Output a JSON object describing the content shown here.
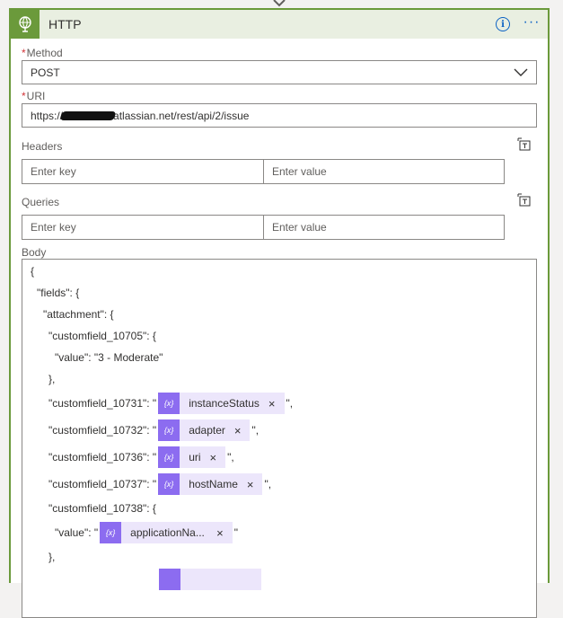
{
  "header": {
    "title": "HTTP",
    "info_glyph": "i",
    "more_glyph": "···",
    "accent": "#6b9a3b"
  },
  "method": {
    "label": "Method",
    "required_mark": "*",
    "value": "POST"
  },
  "uri": {
    "label": "URI",
    "required_mark": "*",
    "value_prefix": "https://",
    "value_suffix": "atlassian.net/rest/api/2/issue"
  },
  "headers": {
    "label": "Headers",
    "key_placeholder": "Enter key",
    "value_placeholder": "Enter value"
  },
  "queries": {
    "label": "Queries",
    "key_placeholder": "Enter key",
    "value_placeholder": "Enter value"
  },
  "body": {
    "label": "Body",
    "lines": {
      "l1": "{",
      "l2": "\"fields\": {",
      "l3": "\"attachment\": {",
      "l4": "\"customfield_10705\": {",
      "l5": "\"value\": \"3 - Moderate\"",
      "l6": "},",
      "l7_pre": "\"customfield_10731\": \"",
      "l7_post": "\",",
      "l8_pre": "\"customfield_10732\": \"",
      "l8_post": "\",",
      "l9_pre": "\"customfield_10736\": \"",
      "l9_post": "\",",
      "l10_pre": "\"customfield_10737\": \"",
      "l10_post": "\",",
      "l11": "\"customfield_10738\": {",
      "l12_pre": "\"value\": \"",
      "l12_post": "\"",
      "l13": "},"
    },
    "tokens": {
      "t1": "instanceStatus",
      "t2": "adapter",
      "t3": "uri",
      "t4": "hostName",
      "t5": "applicationNa..."
    },
    "token_icon_text": "{x}",
    "remove_glyph": "×",
    "token_color": "#8c6cf0"
  }
}
